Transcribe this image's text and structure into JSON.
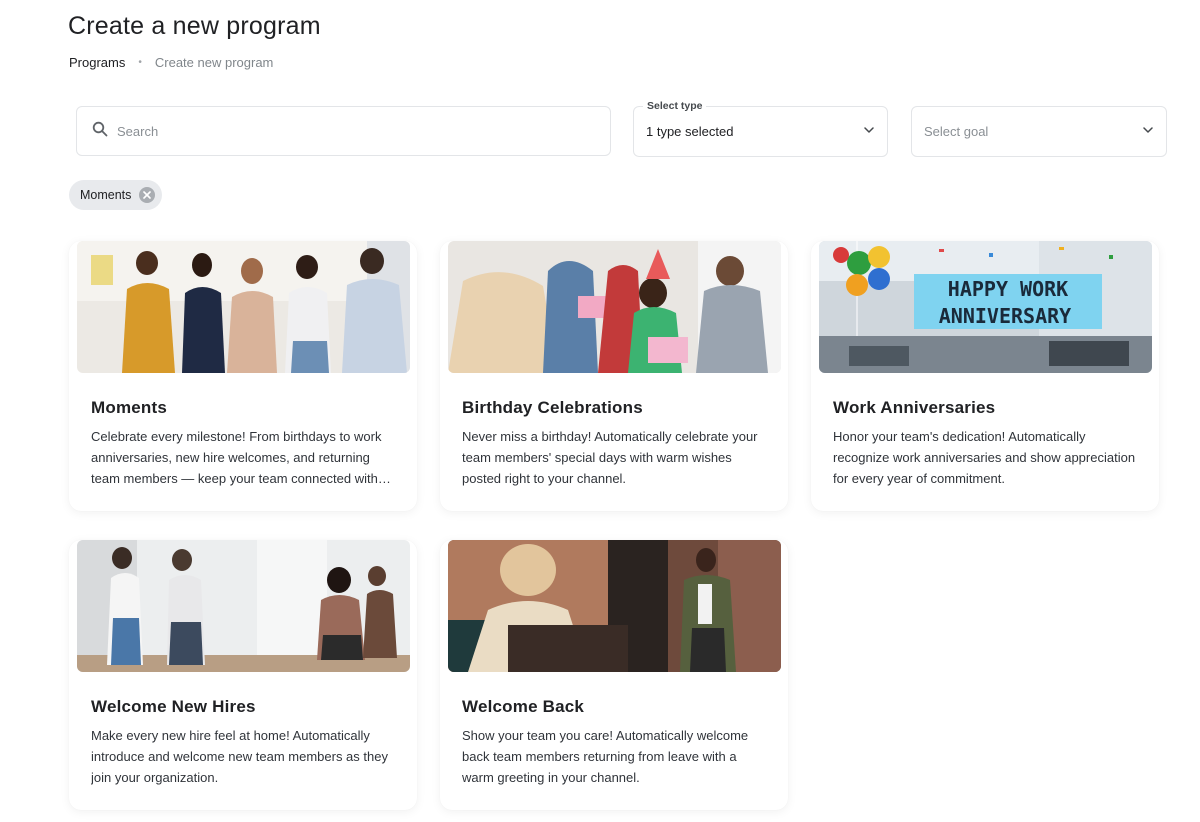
{
  "header": {
    "title": "Create a new program",
    "breadcrumb": {
      "parent": "Programs",
      "separator": "•",
      "current": "Create new program"
    }
  },
  "filters": {
    "search": {
      "placeholder": "Search",
      "value": ""
    },
    "type": {
      "label": "Select type",
      "value": "1 type selected"
    },
    "goal": {
      "placeholder": "Select goal"
    },
    "chips": [
      {
        "label": "Moments"
      }
    ]
  },
  "cards": [
    {
      "title": "Moments",
      "description": "Celebrate every milestone! From birthdays to work anniversaries, new hire welcomes, and returning team members — keep your team connected with every moment that matters.",
      "image": "office-celebration-photo"
    },
    {
      "title": "Birthday Celebrations",
      "description": "Never miss a birthday! Automatically celebrate your team members' special days with warm wishes posted right to your channel.",
      "image": "birthday-party-photo"
    },
    {
      "title": "Work Anniversaries",
      "description": "Honor your team's dedication! Automatically recognize work anniversaries and show appreciation for every year of commitment.",
      "image": "happy-work-anniversary-banner",
      "image_text": "HAPPY WORK ANNIVERSARY"
    },
    {
      "title": "Welcome New Hires",
      "description": "Make every new hire feel at home! Automatically introduce and welcome new team members as they join your organization.",
      "image": "office-dancing-photo"
    },
    {
      "title": "Welcome Back",
      "description": "Show your team you care! Automatically welcome back team members returning from leave with a warm greeting in your channel.",
      "image": "office-return-photo"
    }
  ],
  "colors": {
    "text_primary": "#202124",
    "text_muted": "#80868b",
    "border": "#e3e5e8",
    "chip_bg": "#e8eaed"
  }
}
